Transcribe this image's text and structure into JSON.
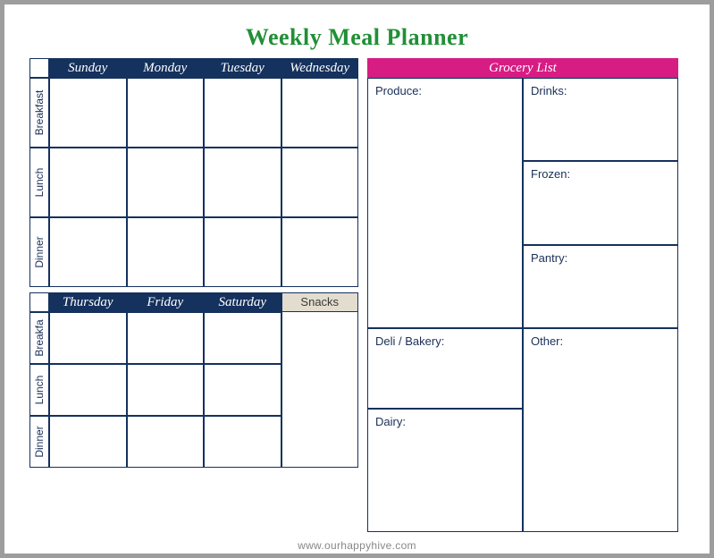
{
  "title": "Weekly Meal Planner",
  "footer": "www.ourhappyhive.com",
  "days_top": [
    "Sunday",
    "Monday",
    "Tuesday",
    "Wednesday"
  ],
  "days_bottom": [
    "Thursday",
    "Friday",
    "Saturday"
  ],
  "snacks_label": "Snacks",
  "meals": [
    "Breakfast",
    "Lunch",
    "Dinner"
  ],
  "meals2": [
    "Breakfa",
    "Lunch",
    "Dinner"
  ],
  "grocery": {
    "header": "Grocery List",
    "produce": "Produce:",
    "deli": "Deli / Bakery:",
    "dairy": "Dairy:",
    "drinks": "Drinks:",
    "frozen": "Frozen:",
    "pantry": "Pantry:",
    "other": "Other:"
  }
}
